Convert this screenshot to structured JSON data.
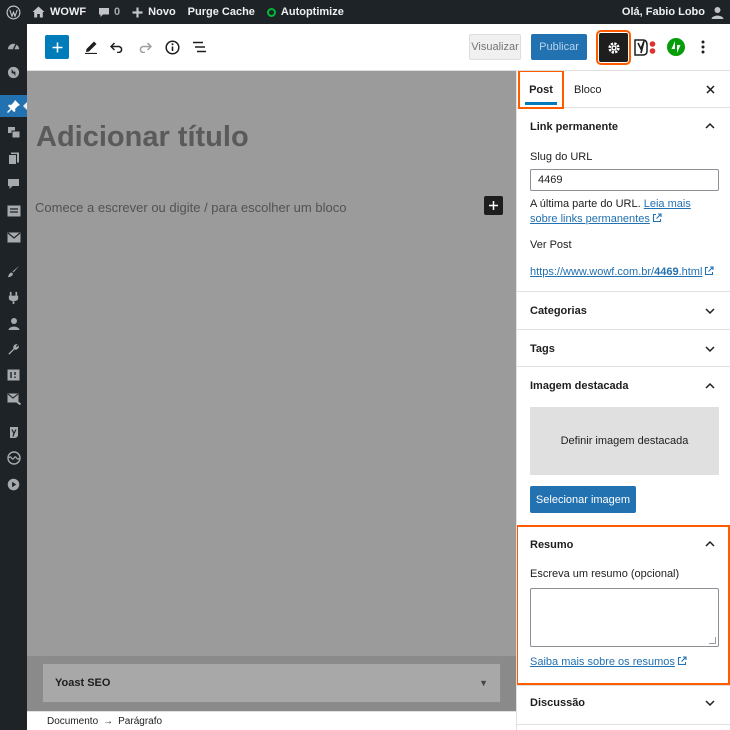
{
  "admin_bar": {
    "wp_icon": "wordpress-logo-icon",
    "site_name": "WOWF",
    "comments_count": "0",
    "new_label": "Novo",
    "purge_cache_label": "Purge Cache",
    "autoptimize_label": "Autoptimize",
    "greeting": "Olá, Fabio Lobo"
  },
  "toolbar": {
    "preview_label": "Visualizar",
    "publish_label": "Publicar"
  },
  "canvas": {
    "title_placeholder": "Adicionar título",
    "block_placeholder": "Comece a escrever ou digite / para escolher um bloco"
  },
  "metabox": {
    "yoast_title": "Yoast SEO"
  },
  "breadcrumb": {
    "document": "Documento",
    "separator": "→",
    "current": "Parágrafo"
  },
  "sidebar": {
    "tabs": {
      "post": "Post",
      "block": "Bloco"
    },
    "permalink": {
      "title": "Link permanente",
      "slug_label": "Slug do URL",
      "slug_value": "4469",
      "help_text": "A última parte do URL.",
      "help_link": "Leia mais sobre links permanentes",
      "view_post_label": "Ver Post",
      "url_prefix": "https://www.wowf.com.br/",
      "url_bold": "4469",
      "url_suffix": ".html"
    },
    "categories_title": "Categorias",
    "tags_title": "Tags",
    "featured": {
      "title": "Imagem destacada",
      "set_label": "Definir imagem destacada",
      "select_button": "Selecionar imagem"
    },
    "excerpt": {
      "title": "Resumo",
      "field_label": "Escreva um resumo (opcional)",
      "learn_more": "Saiba mais sobre os resumos"
    },
    "discussion_title": "Discussão"
  },
  "colors": {
    "accent": "#2271b1",
    "highlight": "#ff5c00",
    "admin_bar": "#1d2327"
  }
}
